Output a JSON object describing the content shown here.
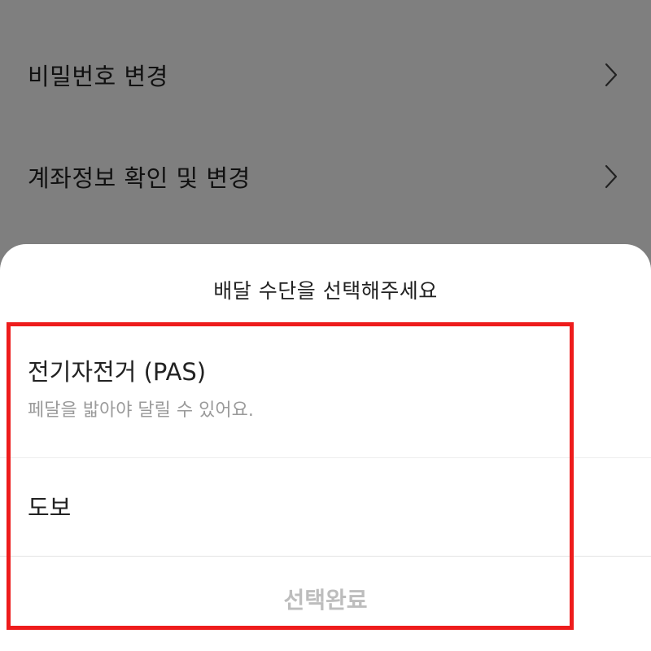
{
  "settings": {
    "items": [
      {
        "label": "비밀번호 변경",
        "icon": "chevron-right-icon"
      },
      {
        "label": "계좌정보 확인 및 변경",
        "icon": "chevron-right-icon"
      }
    ]
  },
  "sheet": {
    "title": "배달 수단을 선택해주세요",
    "options": [
      {
        "label": "전기자전거 (PAS)",
        "description": "페달을 밟아야 달릴 수 있어요."
      },
      {
        "label": "도보"
      }
    ],
    "confirm_label": "선택완료"
  },
  "colors": {
    "overlay": "rgba(0,0,0,0.5)",
    "highlight": "#ee1c1c",
    "confirm_disabled": "#bdbdbd"
  }
}
